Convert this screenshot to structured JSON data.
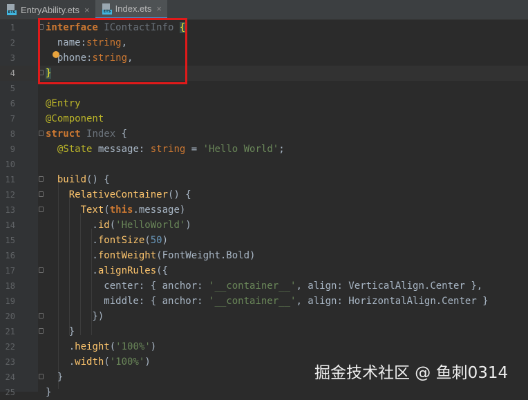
{
  "tabs": [
    {
      "label": "EntryAbility.ets",
      "icon": "ets-file-icon",
      "badge": "ETS",
      "active": false
    },
    {
      "label": "Index.ets",
      "icon": "ets-file-icon",
      "badge": "ETS",
      "active": true
    }
  ],
  "editor": {
    "line_numbers": [
      "1",
      "2",
      "3",
      "4",
      "5",
      "6",
      "7",
      "8",
      "9",
      "10",
      "11",
      "12",
      "13",
      "14",
      "15",
      "16",
      "17",
      "18",
      "19",
      "20",
      "21",
      "22",
      "23",
      "24",
      "25"
    ],
    "current_line": 4
  },
  "watermark": "掘金技术社区 @ 鱼刺0314",
  "colors": {
    "editor_bg": "#2b2b2b",
    "keyword": "#cc7832",
    "string": "#6a8759",
    "function": "#ffc66d",
    "number": "#6897bb",
    "decorator": "#bbb529",
    "highlight_box": "#e01a1a"
  }
}
